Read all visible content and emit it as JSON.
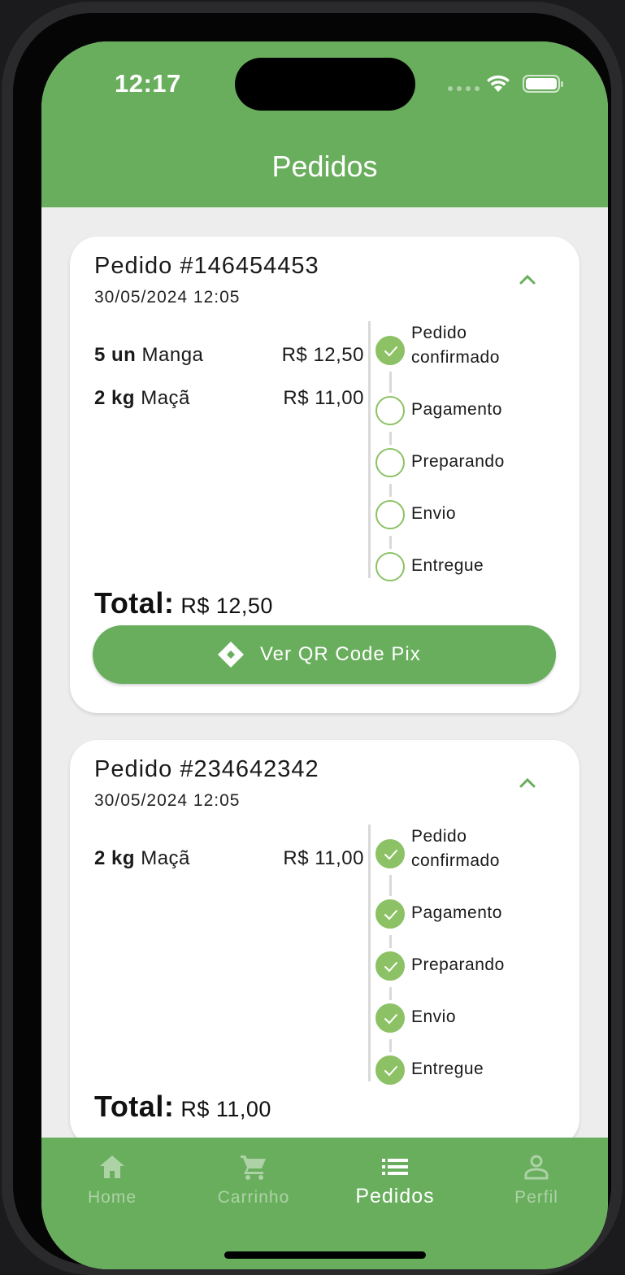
{
  "status_bar": {
    "time": "12:17"
  },
  "header": {
    "title": "Pedidos"
  },
  "orders": [
    {
      "id": "Pedido #146454453",
      "date": "30/05/2024 12:05",
      "items": [
        {
          "qty": "5 un",
          "name": "Manga",
          "price": "R$ 12,50"
        },
        {
          "qty": "2 kg",
          "name": "Maçã",
          "price": "R$ 11,00"
        }
      ],
      "steps": [
        {
          "label": "Pedido confirmado",
          "done": true
        },
        {
          "label": "Pagamento",
          "done": false
        },
        {
          "label": "Preparando",
          "done": false
        },
        {
          "label": "Envio",
          "done": false
        },
        {
          "label": "Entregue",
          "done": false
        }
      ],
      "total_label": "Total:",
      "total_value": "R$ 12,50",
      "pix_button_label": "Ver QR Code Pix"
    },
    {
      "id": "Pedido #234642342",
      "date": "30/05/2024 12:05",
      "items": [
        {
          "qty": "2 kg",
          "name": "Maçã",
          "price": "R$ 11,00"
        }
      ],
      "steps": [
        {
          "label": "Pedido confirmado",
          "done": true
        },
        {
          "label": "Pagamento",
          "done": true
        },
        {
          "label": "Preparando",
          "done": true
        },
        {
          "label": "Envio",
          "done": true
        },
        {
          "label": "Entregue",
          "done": true
        }
      ],
      "total_label": "Total:",
      "total_value": "R$ 11,00"
    }
  ],
  "bottom_nav": {
    "items": [
      {
        "label": "Home",
        "icon": "home-icon",
        "active": false
      },
      {
        "label": "Carrinho",
        "icon": "cart-icon",
        "active": false
      },
      {
        "label": "Pedidos",
        "icon": "list-icon",
        "active": true
      },
      {
        "label": "Perfil",
        "icon": "person-icon",
        "active": false
      }
    ]
  },
  "colors": {
    "primary": "#69ae5d",
    "step_done": "#8cc265",
    "background": "#ededed"
  }
}
